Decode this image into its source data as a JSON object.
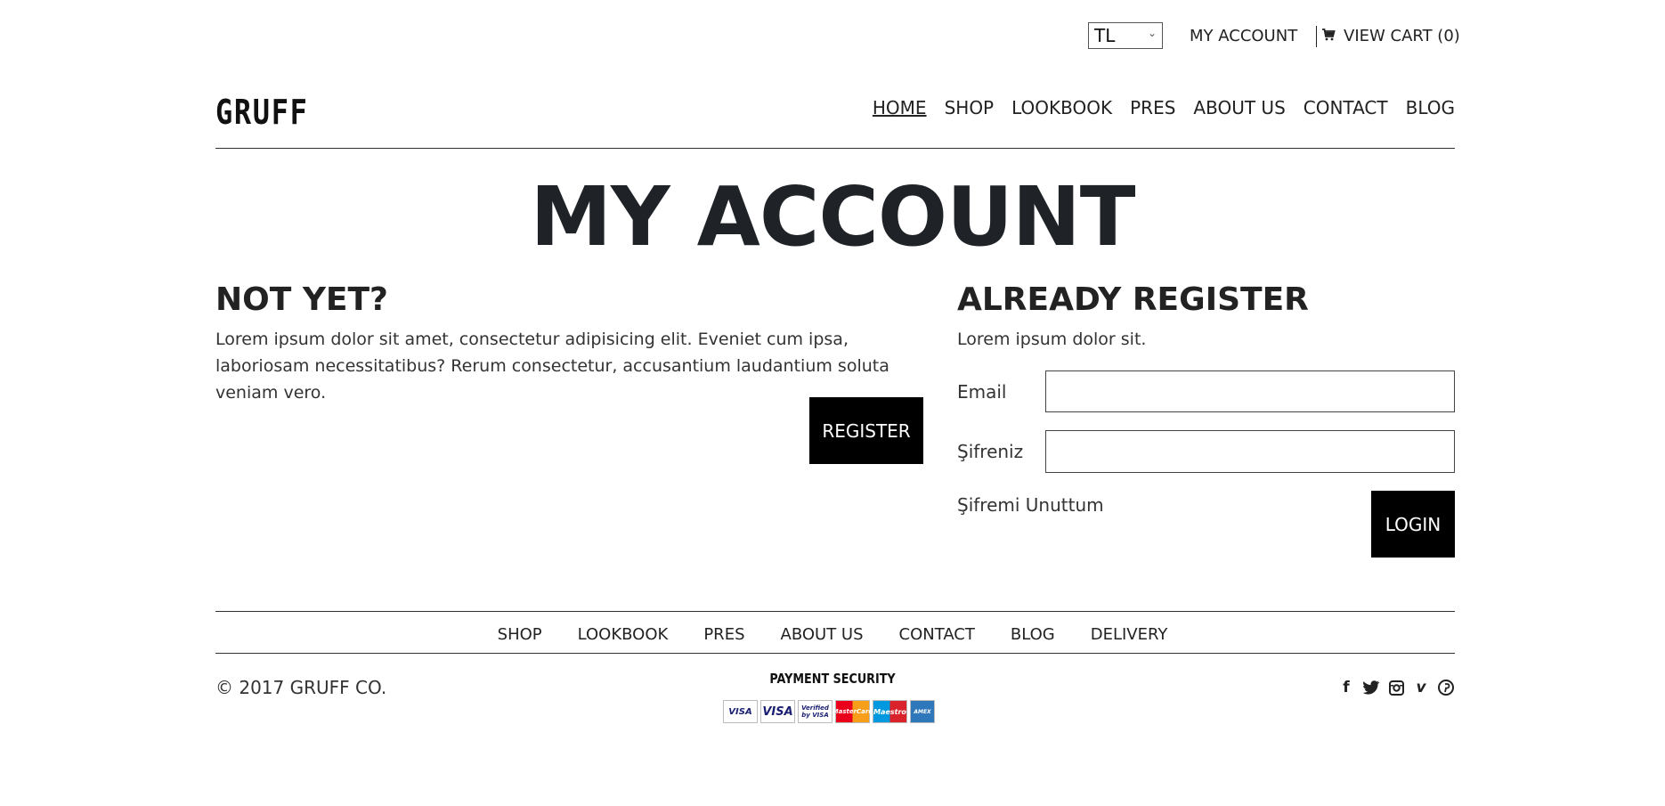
{
  "topbar": {
    "currency": "TL",
    "my_account": "MY ACCOUNT",
    "view_cart": "VIEW CART (0)"
  },
  "logo": "GRUFF",
  "nav": [
    "HOME",
    "SHOP",
    "LOOKBOOK",
    "PRES",
    "ABOUT US",
    "CONTACT",
    "BLOG"
  ],
  "page_title": "MY ACCOUNT",
  "register": {
    "heading": "NOT YET?",
    "text": "Lorem ipsum dolor sit amet, consectetur adipisicing elit. Eveniet cum ipsa, laboriosam necessitatibus? Rerum consectetur, accusantium laudantium soluta veniam vero.",
    "button": "REGISTER"
  },
  "login": {
    "heading": "ALREADY REGISTER",
    "text": "Lorem ipsum dolor sit.",
    "email_label": "Email",
    "password_label": "Şifreniz",
    "forgot": "Şifremi Unuttum",
    "button": "LOGIN"
  },
  "footer": {
    "nav": [
      "SHOP",
      "LOOKBOOK",
      "PRES",
      "ABOUT US",
      "CONTACT",
      "BLOG",
      "DELIVERY"
    ],
    "copyright": "© 2017 GRUFF CO.",
    "payment_title": "PAYMENT SECURITY",
    "payment_cards": [
      "VISA",
      "VISA",
      "Verified by VISA",
      "MasterCard",
      "Maestro",
      "AMEX"
    ],
    "social_icons": [
      "facebook-icon",
      "twitter-icon",
      "instagram-icon",
      "vimeo-icon",
      "pinterest-icon"
    ]
  }
}
